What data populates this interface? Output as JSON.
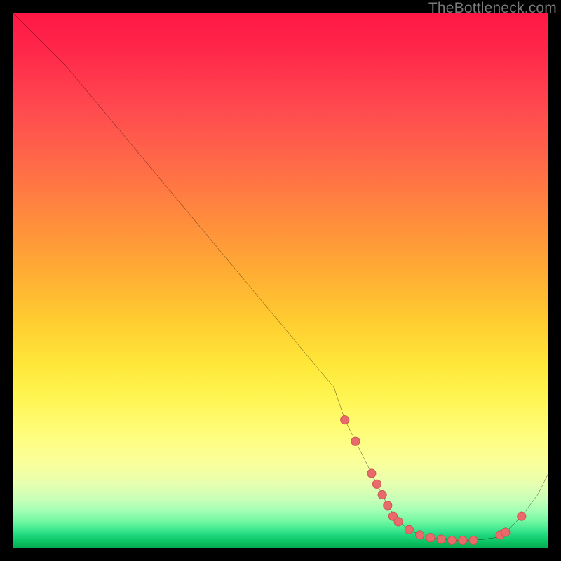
{
  "watermark": "TheBottleneck.com",
  "colors": {
    "frame_bg": "#000000",
    "curve_stroke": "#000000",
    "marker_fill": "#e86a6a",
    "marker_stroke": "#cc5050"
  },
  "chart_data": {
    "type": "line",
    "title": "",
    "xlabel": "",
    "ylabel": "",
    "xlim": [
      0,
      100
    ],
    "ylim": [
      0,
      100
    ],
    "grid": false,
    "legend": false,
    "series": [
      {
        "name": "curve",
        "x": [
          0,
          5,
          10,
          15,
          20,
          25,
          30,
          35,
          40,
          45,
          50,
          55,
          60,
          62,
          65,
          68,
          70,
          72,
          74,
          76,
          78,
          80,
          82,
          84,
          86,
          88,
          90,
          92,
          95,
          98,
          100
        ],
        "y": [
          100,
          95,
          90,
          84,
          78,
          72,
          66,
          60,
          54,
          48,
          42,
          36,
          30,
          24,
          18,
          12,
          8,
          5,
          3.5,
          2.5,
          2,
          1.7,
          1.5,
          1.5,
          1.5,
          1.7,
          2,
          3,
          6,
          10,
          14
        ]
      }
    ],
    "markers": {
      "name": "valley-points",
      "x": [
        62,
        64,
        67,
        68,
        69,
        70,
        71,
        72,
        74,
        76,
        78,
        80,
        82,
        84,
        86,
        91,
        92,
        95
      ],
      "y": [
        24,
        20,
        14,
        12,
        10,
        8,
        6,
        5,
        3.5,
        2.5,
        2,
        1.7,
        1.5,
        1.5,
        1.5,
        2.5,
        3,
        6
      ]
    }
  }
}
